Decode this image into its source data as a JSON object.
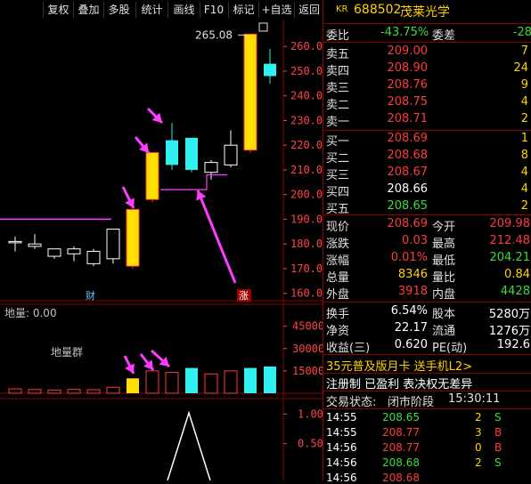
{
  "toolbar": {
    "buttons": [
      "复权",
      "叠加",
      "多股",
      "统计",
      "画线",
      "F10",
      "标记",
      "+自选",
      "返回"
    ]
  },
  "stock": {
    "prefix": "KR",
    "code": "688502",
    "name": "茂莱光学"
  },
  "order_ratio": {
    "label1": "委比",
    "value1": "-43.75%",
    "label2": "委差",
    "value2": "-28"
  },
  "asks": [
    {
      "label": "卖五",
      "price": "209.00",
      "vol": "7"
    },
    {
      "label": "卖四",
      "price": "208.90",
      "vol": "24"
    },
    {
      "label": "卖三",
      "price": "208.76",
      "vol": "9"
    },
    {
      "label": "卖二",
      "price": "208.75",
      "vol": "4"
    },
    {
      "label": "卖一",
      "price": "208.71",
      "vol": "2"
    }
  ],
  "bids": [
    {
      "label": "买一",
      "price": "208.69",
      "vol": "1"
    },
    {
      "label": "买二",
      "price": "208.68",
      "vol": "8"
    },
    {
      "label": "买三",
      "price": "208.67",
      "vol": "4"
    },
    {
      "label": "买四",
      "price": "208.66",
      "vol": "4"
    },
    {
      "label": "买五",
      "price": "208.65",
      "vol": "2"
    }
  ],
  "quote": [
    {
      "l1": "现价",
      "v1": "208.69",
      "l2": "今开",
      "v2": "209.98"
    },
    {
      "l1": "涨跌",
      "v1": "0.03",
      "l2": "最高",
      "v2": "212.48"
    },
    {
      "l1": "涨幅",
      "v1": "0.01%",
      "l2": "最低",
      "v2": "204.21"
    },
    {
      "l1": "总量",
      "v1": "8346",
      "l2": "量比",
      "v2": "0.84"
    },
    {
      "l1": "外盘",
      "v1": "3918",
      "l2": "内盘",
      "v2": "4428"
    }
  ],
  "fundamentals": [
    {
      "l1": "换手",
      "v1": "6.54%",
      "l2": "股本",
      "v2": "5280万"
    },
    {
      "l1": "净资",
      "v1": "22.17",
      "l2": "流通",
      "v2": "1276万"
    },
    {
      "l1": "收益(三)",
      "v1": "0.620",
      "l2": "PE(动)",
      "v2": "192.6"
    }
  ],
  "ads": [
    "35元普及版月卡 送手机L2>",
    "注册制 已盈利 表决权无差异"
  ],
  "trade_status": {
    "label": "交易状态:",
    "value": "闭市阶段",
    "time": "15:30:11"
  },
  "ticks": [
    {
      "time": "14:55",
      "price": "208.65",
      "vol": "2",
      "side": "S"
    },
    {
      "time": "14:55",
      "price": "208.77",
      "vol": "3",
      "side": "B"
    },
    {
      "time": "14:56",
      "price": "208.77",
      "vol": "0",
      "side": "B"
    },
    {
      "time": "14:56",
      "price": "208.68",
      "vol": "2",
      "side": "S"
    },
    {
      "time": "14:56",
      "price": "208.68",
      "vol": "",
      "side": ""
    }
  ],
  "chart_data": {
    "type": "candlestick",
    "y_axis_ticks": [
      160.0,
      170.0,
      180.0,
      190.0,
      200.0,
      210.0,
      220.0,
      230.0,
      240.0,
      250.0,
      260.0
    ],
    "y_range": [
      157,
      268
    ],
    "high_annotation": "265.08",
    "candles": [
      {
        "o": 181,
        "c": 181,
        "h": 183,
        "l": 177,
        "color": "white"
      },
      {
        "o": 179,
        "c": 180,
        "h": 184,
        "l": 178,
        "color": "white"
      },
      {
        "o": 178,
        "c": 175,
        "h": 178,
        "l": 174,
        "color": "white"
      },
      {
        "o": 176,
        "c": 178,
        "h": 179,
        "l": 173,
        "color": "white"
      },
      {
        "o": 172,
        "c": 177,
        "h": 178,
        "l": 171,
        "color": "white"
      },
      {
        "o": 174,
        "c": 186,
        "h": 186,
        "l": 172,
        "color": "white"
      },
      {
        "o": 171,
        "c": 194,
        "h": 194,
        "l": 170,
        "color": "yellow"
      },
      {
        "o": 198,
        "c": 217,
        "h": 217,
        "l": 197,
        "color": "yellow"
      },
      {
        "o": 222,
        "c": 212,
        "h": 229,
        "l": 210,
        "color": "cyan"
      },
      {
        "o": 223,
        "c": 210,
        "h": 223,
        "l": 209,
        "color": "cyan"
      },
      {
        "o": 209,
        "c": 213,
        "h": 214,
        "l": 206,
        "color": "white"
      },
      {
        "o": 212,
        "c": 220,
        "h": 226,
        "l": 211,
        "color": "white"
      },
      {
        "o": 218,
        "c": 265,
        "h": 265,
        "l": 217,
        "color": "yellow"
      },
      {
        "o": 253,
        "c": 248,
        "h": 259,
        "l": 245,
        "color": "cyan"
      }
    ],
    "markers": [
      "财",
      "涨"
    ],
    "volume_panel": {
      "title": "地量: 0.00",
      "annotation": "地量群",
      "y_axis_ticks": [
        15000,
        30000,
        45000
      ],
      "y_range": [
        0,
        55000
      ],
      "bars": [
        {
          "v": 3000,
          "color": "white"
        },
        {
          "v": 2500,
          "color": "white"
        },
        {
          "v": 2200,
          "color": "white"
        },
        {
          "v": 2600,
          "color": "white"
        },
        {
          "v": 2400,
          "color": "white"
        },
        {
          "v": 4000,
          "color": "white"
        },
        {
          "v": 10000,
          "color": "yellow"
        },
        {
          "v": 15000,
          "color": "white"
        },
        {
          "v": 14000,
          "color": "white"
        },
        {
          "v": 17000,
          "color": "cyan"
        },
        {
          "v": 13000,
          "color": "white"
        },
        {
          "v": 15000,
          "color": "white"
        },
        {
          "v": 17000,
          "color": "cyan"
        },
        {
          "v": 18000,
          "color": "cyan"
        }
      ]
    },
    "indicator_panel": {
      "y_axis_ticks": [
        0.5,
        1.0
      ]
    }
  }
}
